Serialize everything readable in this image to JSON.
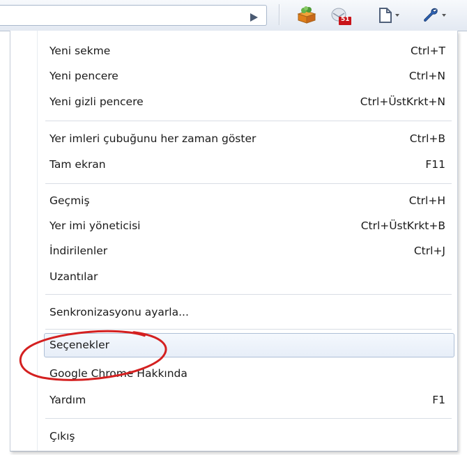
{
  "menu": {
    "items": [
      {
        "label": "Yeni sekme",
        "shortcut": "Ctrl+T"
      },
      {
        "label": "Yeni pencere",
        "shortcut": "Ctrl+N"
      },
      {
        "label": "Yeni gizli pencere",
        "shortcut": "Ctrl+ÜstKrkt+N"
      },
      {
        "label": "Yer imleri çubuğunu her zaman göster",
        "shortcut": "Ctrl+B"
      },
      {
        "label": "Tam ekran",
        "shortcut": "F11"
      },
      {
        "label": "Geçmiş",
        "shortcut": "Ctrl+H"
      },
      {
        "label": "Yer imi yöneticisi",
        "shortcut": "Ctrl+ÜstKrkt+B"
      },
      {
        "label": "İndirilenler",
        "shortcut": "Ctrl+J"
      },
      {
        "label": "Uzantılar",
        "shortcut": ""
      },
      {
        "label": "Senkronizasyonu ayarla...",
        "shortcut": ""
      },
      {
        "label": "Seçenekler",
        "shortcut": ""
      },
      {
        "label": "Google Chrome Hakkında",
        "shortcut": ""
      },
      {
        "label": "Yardım",
        "shortcut": "F1"
      },
      {
        "label": "Çıkış",
        "shortcut": ""
      }
    ],
    "highlighted_item": "Seçenekler"
  },
  "toolbar": {
    "icons": [
      "play-go-icon",
      "extension-box-icon",
      "mail-notification-icon",
      "page-menu-icon",
      "wrench-icon"
    ],
    "mail_badge": "51"
  },
  "colors": {
    "highlight_border": "#aebfd6",
    "annotation_red": "#d42020"
  }
}
